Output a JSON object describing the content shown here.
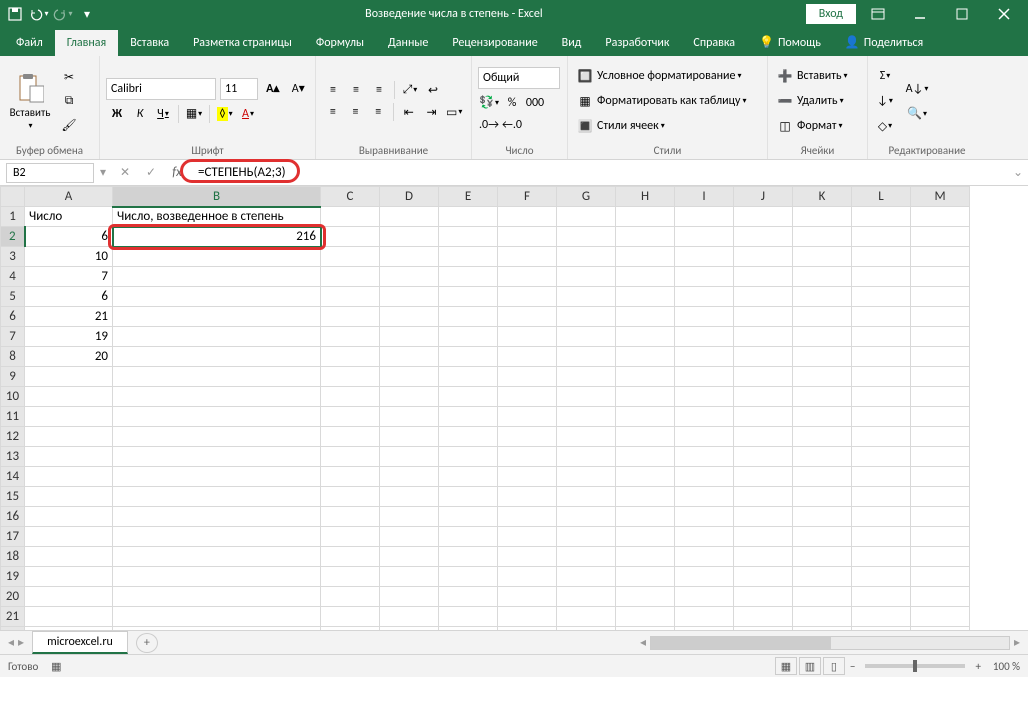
{
  "title": "Возведение числа в степень  -  Excel",
  "login": "Вход",
  "tabs": [
    "Файл",
    "Главная",
    "Вставка",
    "Разметка страницы",
    "Формулы",
    "Данные",
    "Рецензирование",
    "Вид",
    "Разработчик",
    "Справка",
    "Помощь",
    "Поделиться"
  ],
  "active_tab": 1,
  "ribbon": {
    "clipboard": {
      "title": "Буфер обмена",
      "paste": "Вставить"
    },
    "font": {
      "title": "Шрифт",
      "name": "Calibri",
      "size": "11",
      "bold": "Ж",
      "italic": "К",
      "underline": "Ч"
    },
    "alignment": {
      "title": "Выравнивание"
    },
    "number": {
      "title": "Число",
      "format": "Общий"
    },
    "styles": {
      "title": "Стили",
      "cond": "Условное форматирование",
      "table": "Форматировать как таблицу",
      "cell": "Стили ячеек"
    },
    "cells": {
      "title": "Ячейки",
      "insert": "Вставить",
      "delete": "Удалить",
      "format": "Формат"
    },
    "editing": {
      "title": "Редактирование"
    }
  },
  "name_box": "B2",
  "formula": "=СТЕПЕНЬ(A2;3)",
  "columns": [
    "A",
    "B",
    "C",
    "D",
    "E",
    "F",
    "G",
    "H",
    "I",
    "J",
    "K",
    "L",
    "M"
  ],
  "headers": {
    "A": "Число",
    "B": "Число, возведенное в степень"
  },
  "colA_data": [
    "6",
    "10",
    "7",
    "6",
    "21",
    "19",
    "20"
  ],
  "b2_value": "216",
  "row_count": 22,
  "sheet_tab": "microexcel.ru",
  "status_text": "Готово",
  "zoom": "100 %"
}
